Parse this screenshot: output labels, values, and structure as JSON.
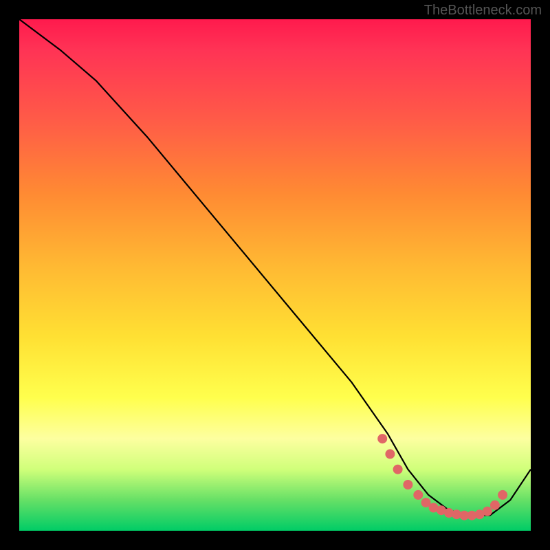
{
  "watermark": "TheBottleneck.com",
  "chart_data": {
    "type": "line",
    "title": "",
    "xlabel": "",
    "ylabel": "",
    "xlim": [
      0,
      100
    ],
    "ylim": [
      0,
      100
    ],
    "series": [
      {
        "name": "curve",
        "x": [
          0,
          8,
          15,
          25,
          35,
          45,
          55,
          65,
          72,
          76,
          80,
          84,
          88,
          92,
          96,
          100
        ],
        "y": [
          100,
          94,
          88,
          77,
          65,
          53,
          41,
          29,
          19,
          12,
          7,
          4,
          3,
          3,
          6,
          12
        ],
        "color": "#000000"
      }
    ],
    "markers": [
      {
        "name": "dots",
        "x": [
          71,
          72.5,
          74,
          76,
          78,
          79.5,
          81,
          82.5,
          84,
          85.5,
          87,
          88.5,
          90,
          91.5,
          93,
          94.5
        ],
        "y": [
          18,
          15,
          12,
          9,
          7,
          5.5,
          4.5,
          4,
          3.5,
          3.2,
          3,
          3,
          3.2,
          3.8,
          5,
          7
        ],
        "color": "#e06666",
        "size": 7
      }
    ],
    "background_gradient": {
      "type": "vertical",
      "stops": [
        {
          "pos": 0,
          "color": "#ff1a4d"
        },
        {
          "pos": 0.5,
          "color": "#ffcc33"
        },
        {
          "pos": 0.78,
          "color": "#ffff66"
        },
        {
          "pos": 1.0,
          "color": "#00cc66"
        }
      ]
    }
  }
}
